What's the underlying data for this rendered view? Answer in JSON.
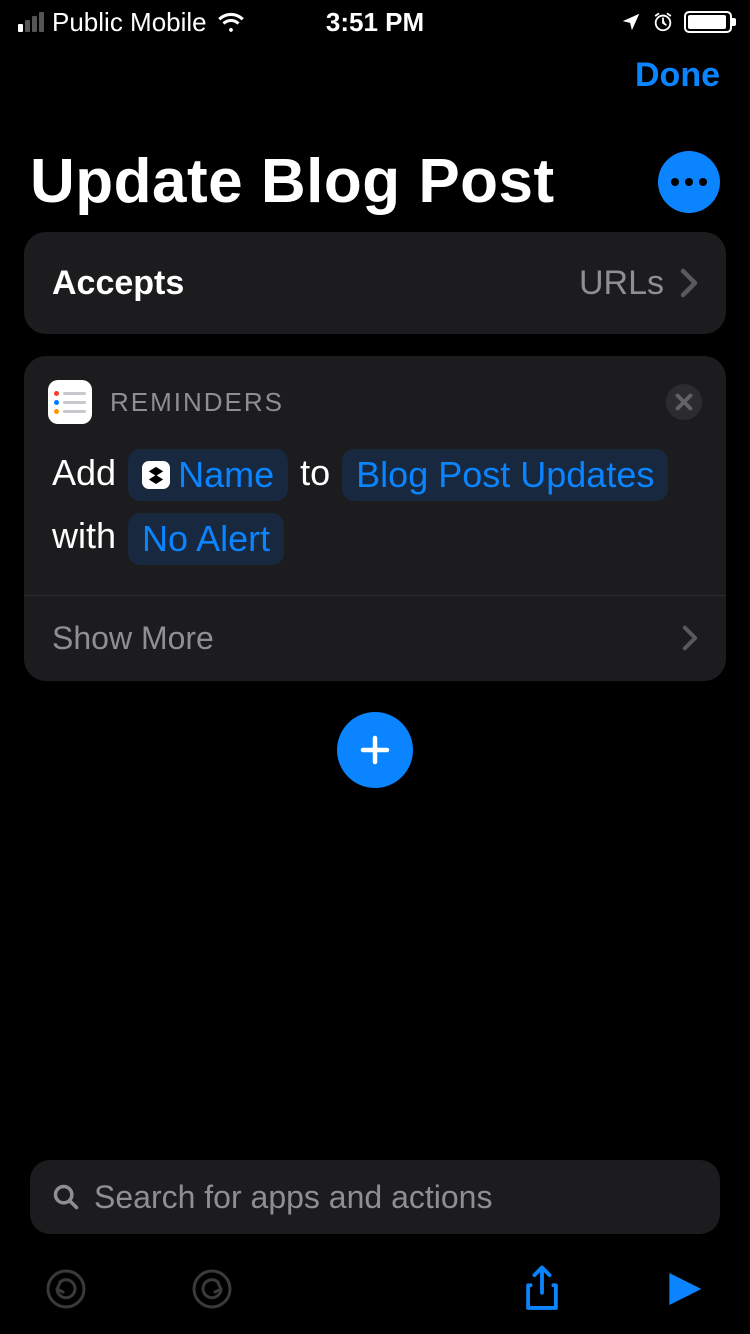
{
  "status": {
    "carrier": "Public Mobile",
    "time": "3:51 PM"
  },
  "nav": {
    "done": "Done"
  },
  "title": "Update Blog Post",
  "accepts": {
    "label": "Accepts",
    "value": "URLs"
  },
  "action": {
    "app": "REMINDERS",
    "word_add": "Add",
    "token_name": "Name",
    "word_to": "to",
    "token_list": "Blog Post Updates",
    "word_with": "with",
    "token_alert": "No Alert",
    "show_more": "Show More"
  },
  "search": {
    "placeholder": "Search for apps and actions"
  },
  "colors": {
    "accent": "#0a84ff",
    "card": "#1c1c1e",
    "muted": "#8e8e93"
  }
}
